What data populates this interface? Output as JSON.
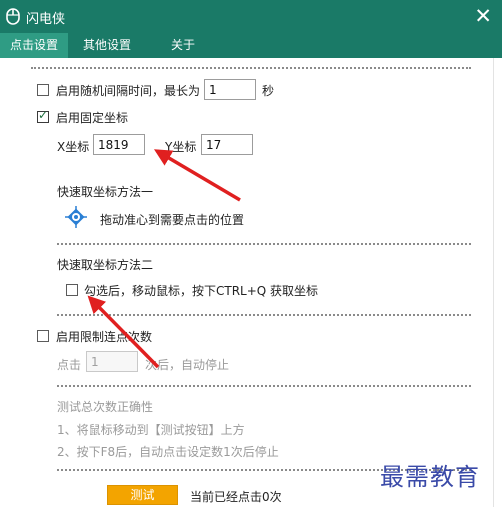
{
  "window": {
    "title": "闪电侠",
    "close_glyph": "✕"
  },
  "tabs": [
    {
      "label": "点击设置",
      "active": true
    },
    {
      "label": "其他设置",
      "active": false
    },
    {
      "label": "关于",
      "active": false
    }
  ],
  "random_interval": {
    "label": "启用随机间隔时间，最长为",
    "value": "1",
    "unit": "秒",
    "checked": false
  },
  "fixed_coord": {
    "label": "启用固定坐标",
    "checked": true,
    "x_label": "X坐标",
    "x_value": "1819",
    "y_label": "Y坐标",
    "y_value": "17"
  },
  "method_one": {
    "title": "快速取坐标方法一",
    "hint": "拖动准心到需要点击的位置",
    "icon": "crosshair-icon"
  },
  "method_two": {
    "title": "快速取坐标方法二",
    "label": "勾选后，移动鼠标，按下CTRL+Q 获取坐标",
    "checked": false
  },
  "limit": {
    "label": "启用限制连点次数",
    "checked": false,
    "prefix": "点击",
    "value": "1",
    "suffix": "次后，自动停止"
  },
  "test": {
    "title": "测试总次数正确性",
    "step1": "1、将鼠标移动到【测试按钮】上方",
    "step2": "2、按下F8后，自动点击设定数1次后停止",
    "button_label": "测试",
    "status": "当前已经点击0次"
  },
  "watermark": "最需教育",
  "colors": {
    "titlebar": "#1a7a67",
    "active_tab": "#2f9c84",
    "button": "#f3a400",
    "arrow": "#e02020"
  }
}
